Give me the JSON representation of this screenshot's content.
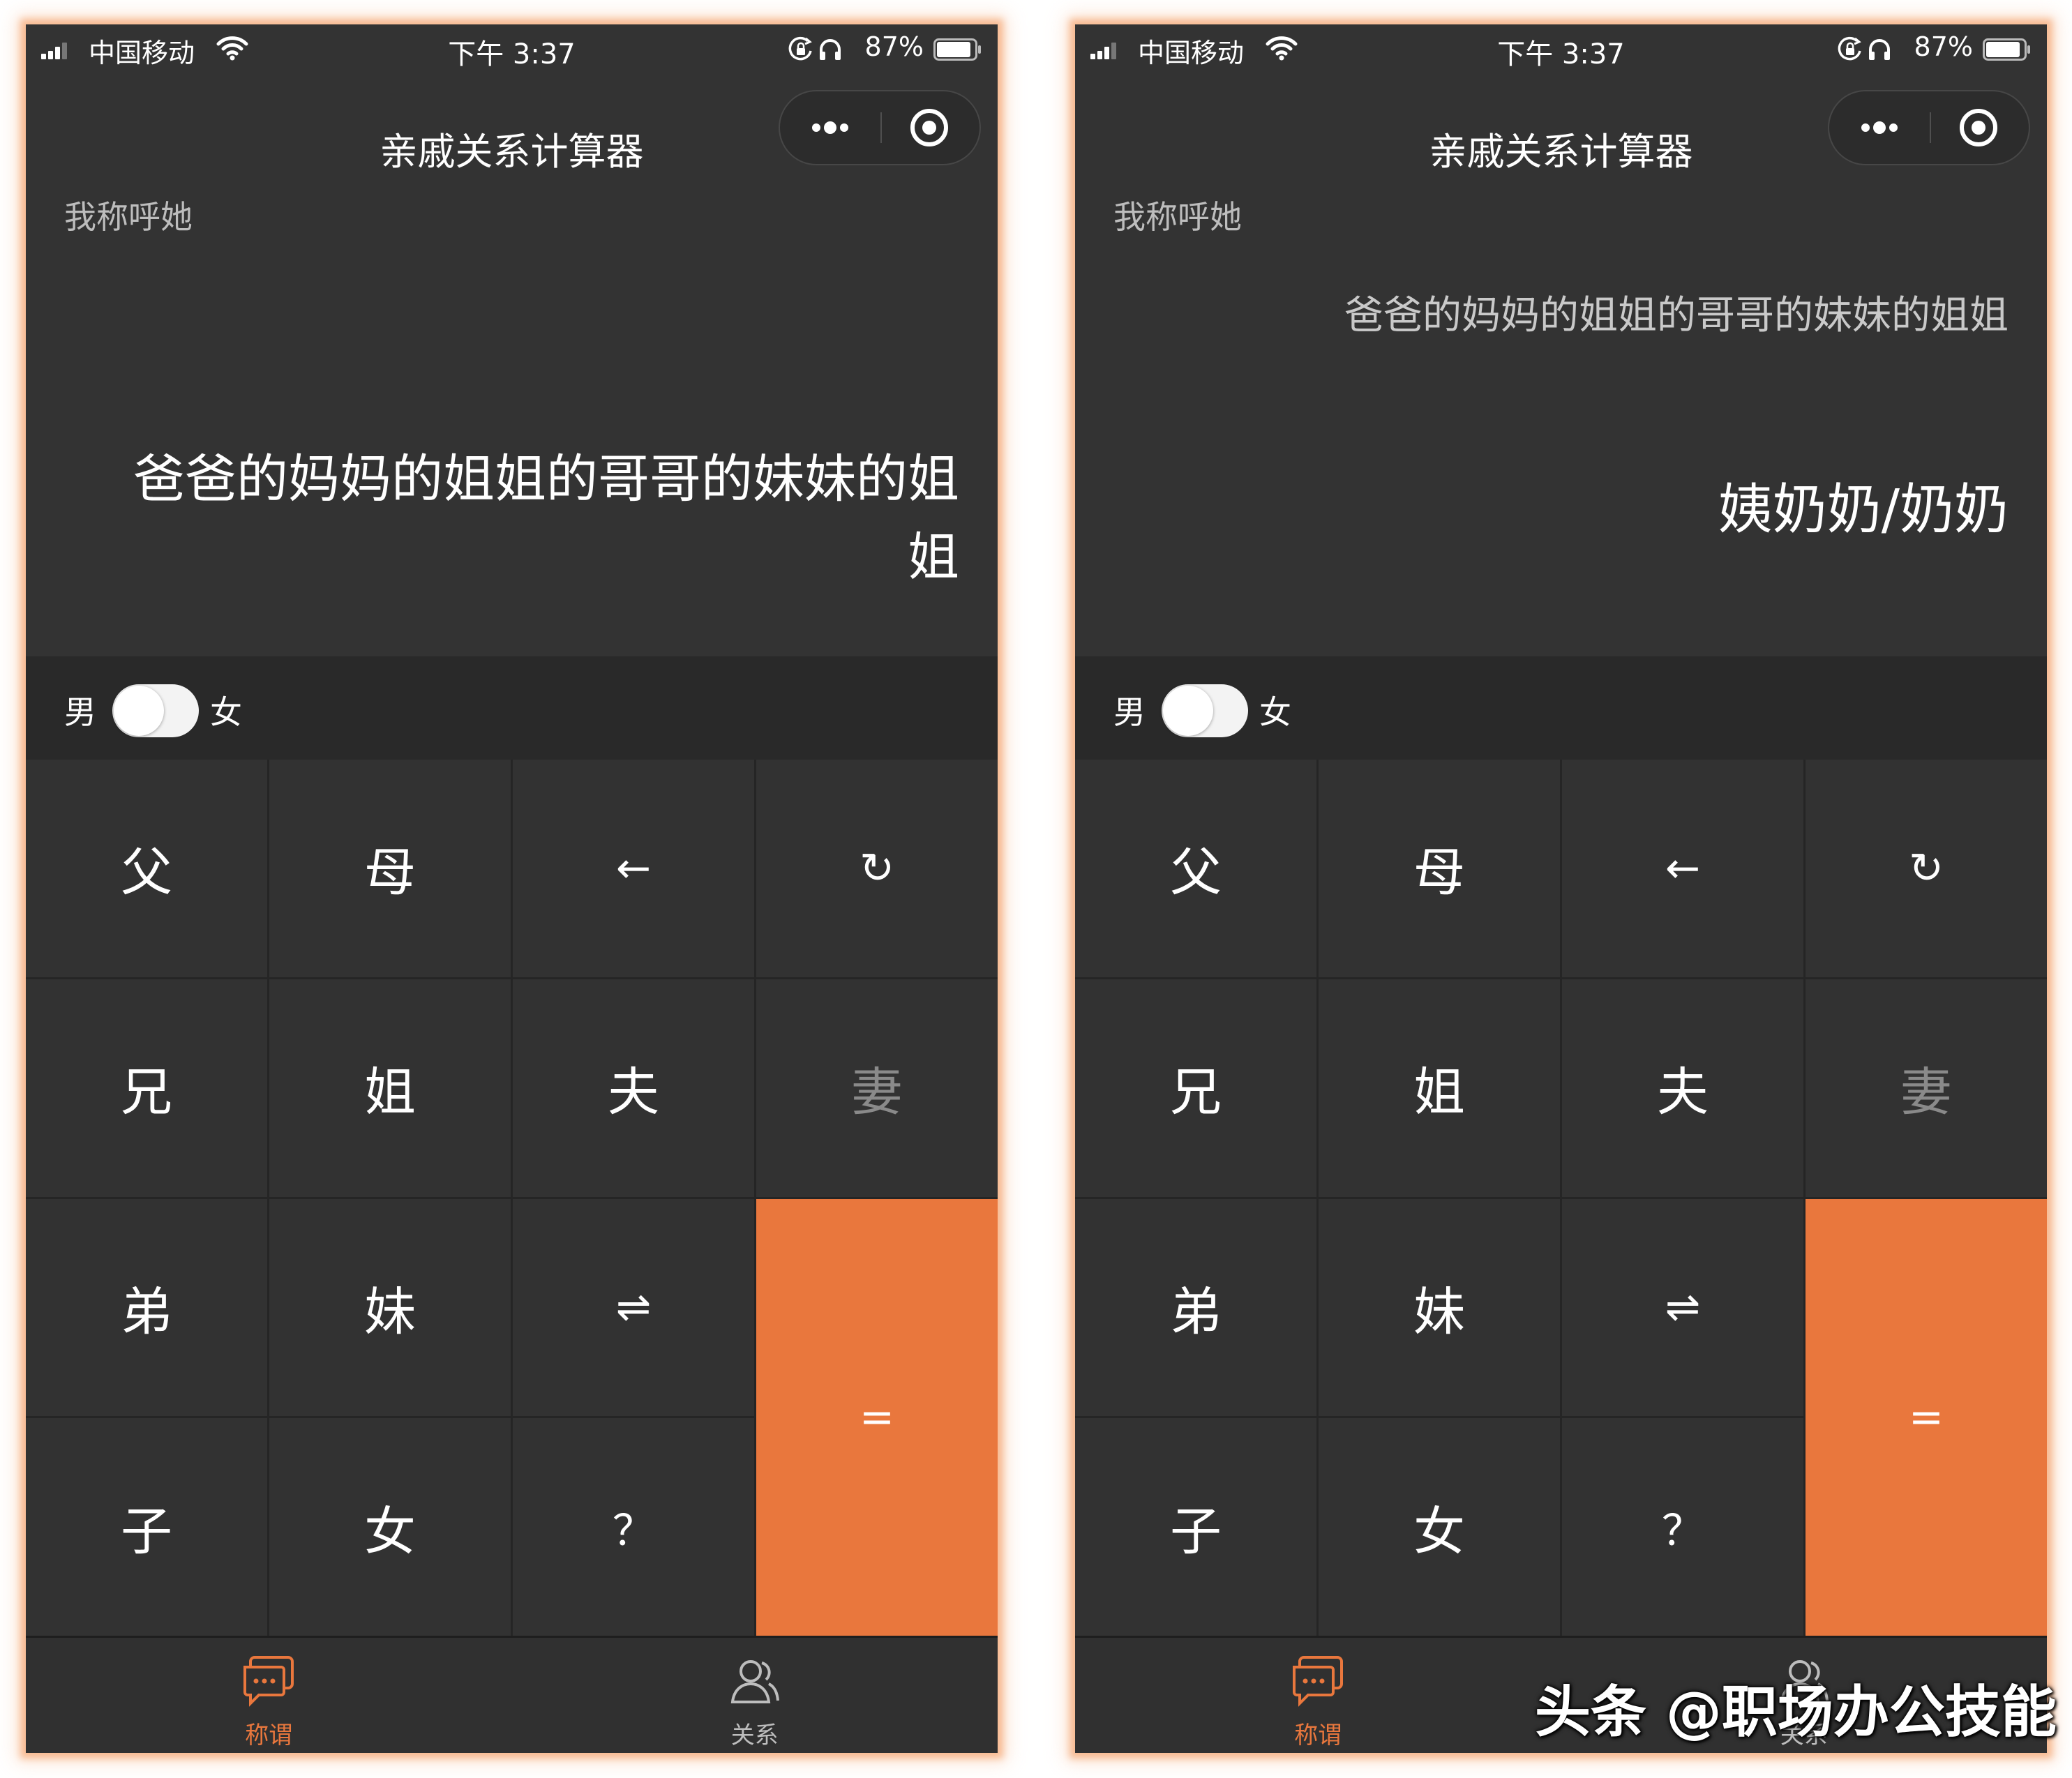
{
  "status_bar": {
    "carrier": "中国移动",
    "time": "下午 3:37",
    "battery": "87%"
  },
  "app": {
    "title": "亲戚关系计算器"
  },
  "prompt_label": "我称呼她",
  "gender": {
    "male_label": "男",
    "female_label": "女"
  },
  "keys": [
    "父",
    "母",
    "←",
    "↻",
    "兄",
    "姐",
    "夫",
    "妻",
    "弟",
    "妹",
    "⇌",
    "子",
    "女",
    "？"
  ],
  "equals_label": "=",
  "tabs": [
    {
      "label": "称谓"
    },
    {
      "label": "关系"
    }
  ],
  "screens": [
    {
      "expression": "爸爸的妈妈的姐姐的哥哥的妹妹的姐姐"
    },
    {
      "expression": "爸爸的妈妈的姐姐的哥哥的妹妹的姐姐",
      "result": "姨奶奶/奶奶"
    }
  ],
  "watermark": "头条 @职场办公技能",
  "colors": {
    "background": "#333333",
    "accent": "#e9773d",
    "text": "#ffffff",
    "muted_text": "#bdbdbd",
    "dim_key": "#8a8a8a"
  }
}
